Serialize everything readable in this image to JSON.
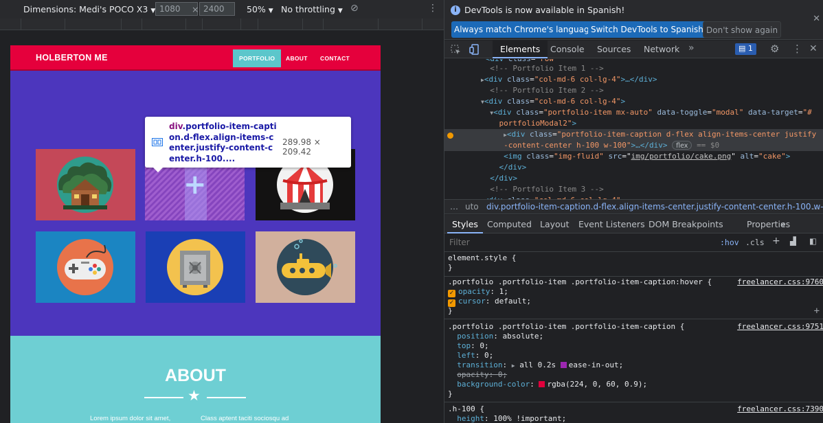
{
  "device_toolbar": {
    "device_label": "Dimensions: Medi's POCO X3",
    "width_value": "1080",
    "times": "×",
    "height_value": "2400",
    "zoom": "50%",
    "throttle": "No throttling"
  },
  "site": {
    "brand": "HOLBERTON ME",
    "nav": [
      "PORTFOLIO",
      "ABOUT",
      "CONTACT"
    ],
    "about_title": "ABOUT",
    "about_text_left": "Lorem ipsum dolor sit amet,",
    "about_text_right": "Class aptent taciti sociosqu ad",
    "portfolio_items": [
      "cabin",
      "cake",
      "circus",
      "game",
      "safe",
      "submarine"
    ],
    "colors": {
      "nav_red": "#e5003c",
      "portfolio_bg": "#4c36bd",
      "about_bg": "#6ecfd3",
      "active_nav": "#5cc6cb"
    }
  },
  "inspect_tooltip": {
    "tag": "div",
    "classes": ".portfolio-item-caption.d-flex.align-items-center.justify-content-center.h-100....",
    "size": "289.98 × 209.42"
  },
  "infobar": {
    "message": "DevTools is now available in Spanish!",
    "btn_match": "Always match Chrome's language",
    "btn_switch": "Switch DevTools to Spanish",
    "btn_dont": "Don't show again"
  },
  "devtools_tabs": [
    "Elements",
    "Console",
    "Sources",
    "Network"
  ],
  "issues_count": "1",
  "dom": {
    "l0": "<div class=\"col-md-6 col-lg-4\">",
    "c1": "<!-- Portfolio Item 1 -->",
    "c2": "<!-- Portfolio Item 2 -->",
    "c3": "<!-- Portfolio Item 3 -->",
    "div_open": "div",
    "class_attr": "class",
    "col_class": "\"col-md-6 col-lg-4\"",
    "ellipsis_close": ">…</div>",
    "open_close": ">",
    "item_class": "\"portfolio-item mx-auto\"",
    "toggle_attr": "data-toggle",
    "toggle_val": "\"modal\"",
    "target_attr": "data-target",
    "target_val": "\"#",
    "target_val2": "portfolioModal2\"",
    "caption_class_a": "\"portfolio-item-caption d-flex align-items-center justify",
    "caption_class_b": "-content-center h-100 w-100\"",
    "flex_pill": "flex",
    "eq0": "== $0",
    "img_tag": "img",
    "img_class": "\"img-fluid\"",
    "src_attr": "src",
    "src_val": "img/portfolio/cake.png",
    "alt_attr": "alt",
    "alt_val": "\"cake\"",
    "close_div": "</div>"
  },
  "breadcrumb": {
    "prev": "uto",
    "current": "div.portfolio-item-caption.d-flex.align-items-center.justify-content-center.h-100.w-100"
  },
  "style_tabs": [
    "Styles",
    "Computed",
    "Layout",
    "Event Listeners",
    "DOM Breakpoints",
    "Properties"
  ],
  "filter": {
    "placeholder": "Filter",
    "hov": ":hov",
    "cls": ".cls"
  },
  "styles": {
    "element_style": "element.style {",
    "close_brace": "}",
    "r1_selector": ".portfolio .portfolio-item .portfolio-item-caption:hover {",
    "r1_source": "freelancer.css:9760",
    "r1_p1": "opacity",
    "r1_v1": "1;",
    "r1_p2": "cursor",
    "r1_v2": "default;",
    "r2_selector": ".portfolio .portfolio-item .portfolio-item-caption {",
    "r2_source": "freelancer.css:9751",
    "r2_p1": "position",
    "r2_v1": "absolute;",
    "r2_p2": "top",
    "r2_v2": "0;",
    "r2_p3": "left",
    "r2_v3": "0;",
    "r2_p4": "transition",
    "r2_v4a": "all 0.2s",
    "r2_v4b": "ease-in-out;",
    "r2_p5": "opacity",
    "r2_v5": "0;",
    "r2_p6": "background-color",
    "r2_v6": "rgba(224, 0, 60, 0.9);",
    "r2_swatch": "#e0003c",
    "r3_selector": ".h-100 {",
    "r3_source": "freelancer.css:7390",
    "r3_p1": "height",
    "r3_v1": "100% !important;"
  }
}
